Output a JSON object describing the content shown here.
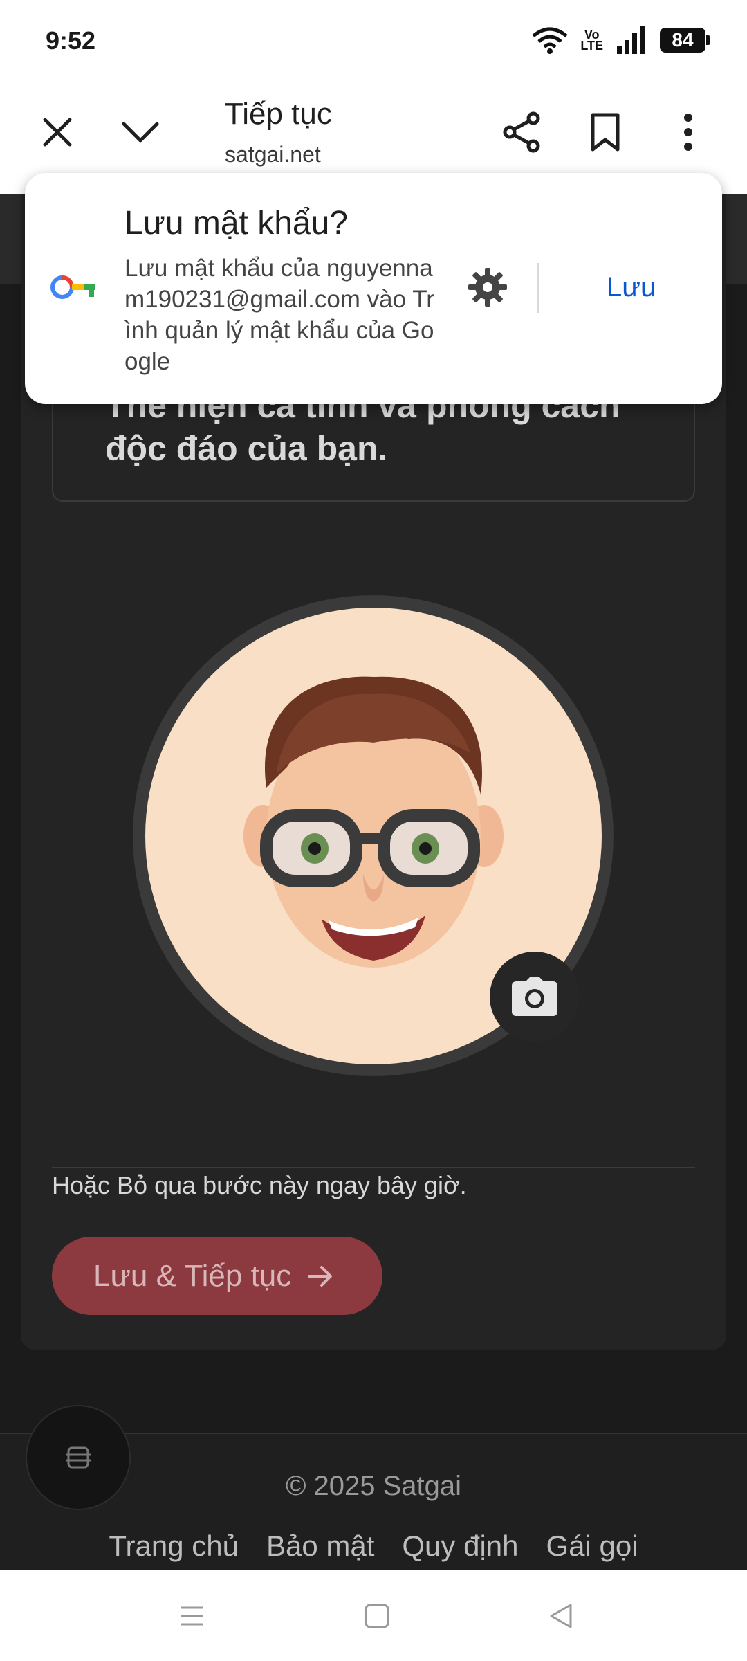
{
  "status_bar": {
    "time": "9:52",
    "volte": "Vo\nLTE",
    "battery": "84"
  },
  "browser": {
    "title": "Tiếp tục",
    "url": "satgai.net",
    "icons": [
      "close-icon",
      "chevron-down-icon",
      "share-icon",
      "bookmark-icon",
      "more-vert-icon"
    ]
  },
  "page": {
    "intro_text": "Thể hiện cá tính và phong cách độc đáo của bạn.",
    "skip_text": "Hoặc Bỏ qua bước này ngay bây giờ.",
    "save_button": "Lưu & Tiếp tục"
  },
  "footer": {
    "copyright": "© 2025 Satgai",
    "links": [
      "Trang chủ",
      "Bảo mật",
      "Quy định",
      "Gái gọi"
    ]
  },
  "password_prompt": {
    "title": "Lưu mật khẩu?",
    "description": "Lưu mật khẩu của nguyennam190231@gmail.com vào Trình quản lý mật khẩu của Google",
    "save_label": "Lưu"
  },
  "colors": {
    "accent_link": "#0b57d0",
    "save_button_bg": "#8c3a3f",
    "page_bg": "#1b1b1b"
  }
}
